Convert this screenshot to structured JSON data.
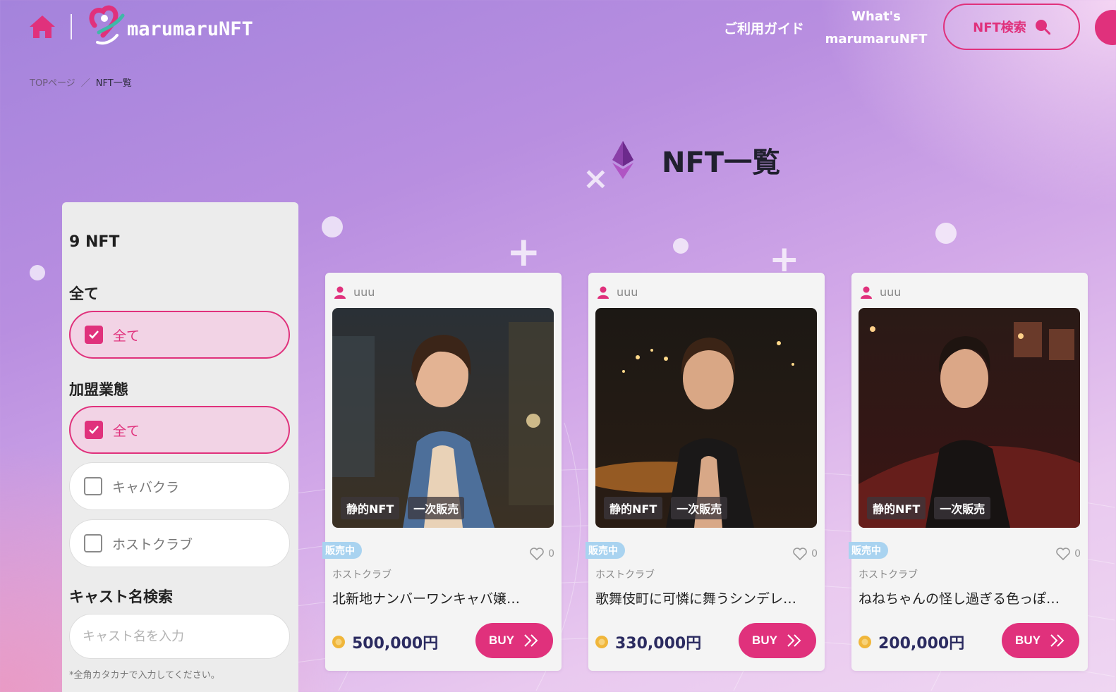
{
  "header": {
    "logo_text": "marumaruNFT",
    "nav_guide": "ご利用ガイド",
    "nav_whats_line1": "What's",
    "nav_whats_line2": "marumaruNFT",
    "search_button": "NFT検索"
  },
  "breadcrumb": {
    "top": "TOPページ",
    "separator": "／",
    "current": "NFT一覧"
  },
  "page_title": "NFT一覧",
  "sidebar": {
    "count": "9 NFT",
    "section_all": "全て",
    "all_option": "全て",
    "section_business": "加盟業態",
    "business_options": [
      {
        "label": "全て",
        "checked": true
      },
      {
        "label": "キャバクラ",
        "checked": false
      },
      {
        "label": "ホストクラブ",
        "checked": false
      }
    ],
    "cast_search_label": "キャスト名検索",
    "cast_search_placeholder": "キャスト名を入力",
    "cast_search_note": "*全角カタカナで入力してください。"
  },
  "cards": [
    {
      "user": "uuu",
      "tags": [
        "静的NFT",
        "一次販売"
      ],
      "badge": "販売中",
      "likes": "0",
      "category": "ホストクラブ",
      "title": "北新地ナンバーワンキャバ嬢…",
      "price": "500,000円",
      "buy": "BUY"
    },
    {
      "user": "uuu",
      "tags": [
        "静的NFT",
        "一次販売"
      ],
      "badge": "販売中",
      "likes": "0",
      "category": "ホストクラブ",
      "title": "歌舞伎町に可憐に舞うシンデレ…",
      "price": "330,000円",
      "buy": "BUY"
    },
    {
      "user": "uuu",
      "tags": [
        "静的NFT",
        "一次販売"
      ],
      "badge": "販売中",
      "likes": "0",
      "category": "ホストクラブ",
      "title": "ねねちゃんの怪し過ぎる色っぽ…",
      "price": "200,000円",
      "buy": "BUY"
    }
  ],
  "colors": {
    "accent": "#e0317c",
    "badge": "#a9d3f0",
    "price": "#2b2b60"
  }
}
